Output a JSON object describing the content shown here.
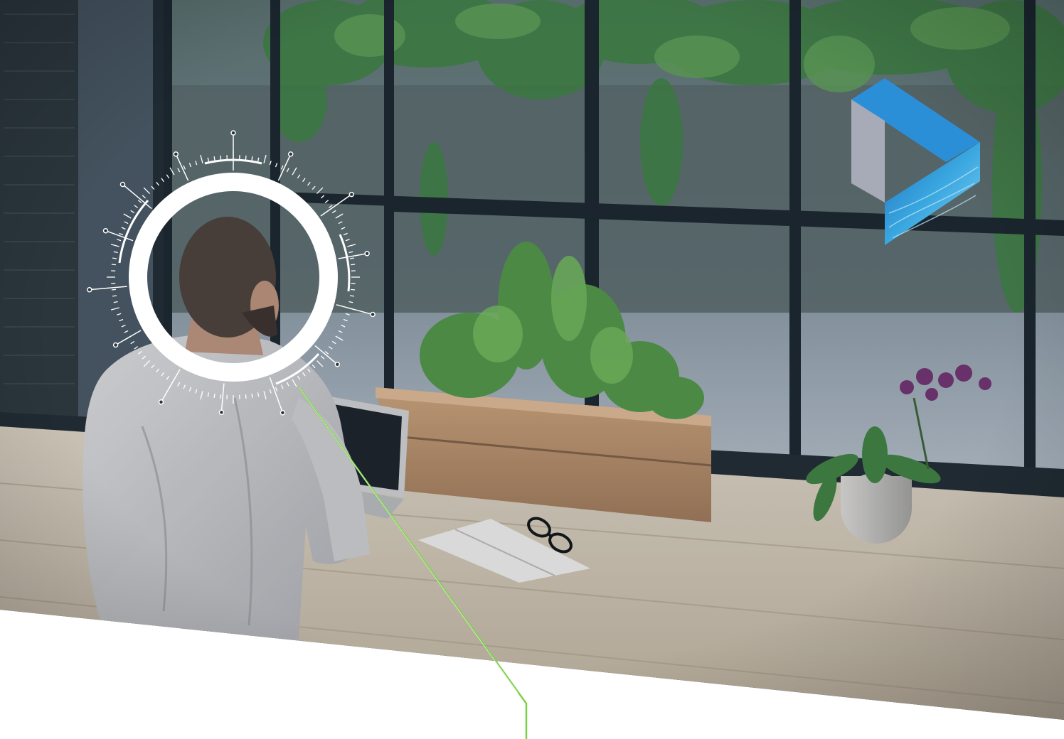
{
  "page": {
    "background_color": "#ffffff"
  },
  "photo": {
    "scene": "office-window-workspace",
    "elements": [
      "man-at-laptop",
      "window-grid",
      "planter-box",
      "orchid-pot",
      "notebook",
      "glasses",
      "ivy-wall"
    ]
  },
  "hud_overlay": {
    "type": "circular-target-reticle",
    "color": "#ffffff"
  },
  "connector_line": {
    "color": "#7bd145"
  },
  "logo": {
    "type": "play-triangle-mark",
    "colors": {
      "top_face": "#2b8fd8",
      "side_face": "#a7abb8",
      "water_face": "#3aa7e0"
    }
  }
}
